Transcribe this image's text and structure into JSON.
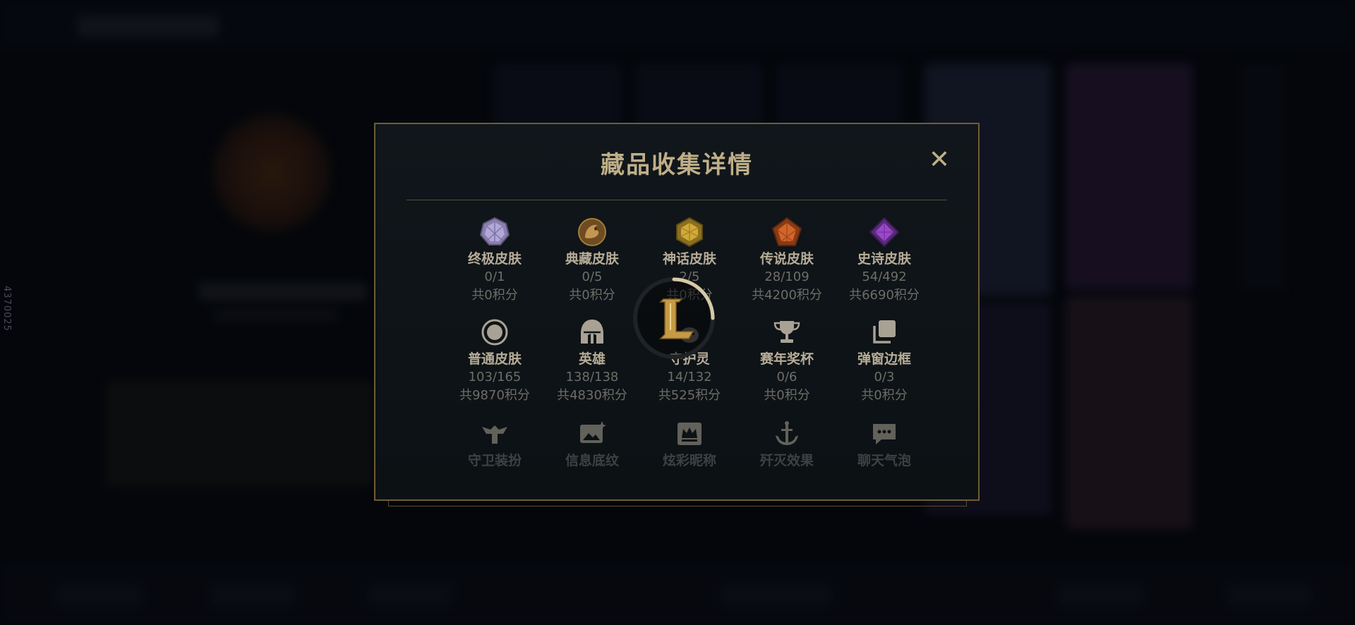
{
  "side_id": "4370025",
  "modal": {
    "title": "藏品收集详情",
    "close_label": "✕",
    "items": [
      {
        "name": "终极皮肤",
        "count": "0/1",
        "points": "共0积分",
        "icon": "ultimate-gem-icon"
      },
      {
        "name": "典藏皮肤",
        "count": "0/5",
        "points": "共0积分",
        "icon": "dragon-medallion-icon"
      },
      {
        "name": "神话皮肤",
        "count": "2/5",
        "points": "共0积分",
        "icon": "mythic-gem-icon"
      },
      {
        "name": "传说皮肤",
        "count": "28/109",
        "points": "共4200积分",
        "icon": "legendary-gem-icon"
      },
      {
        "name": "史诗皮肤",
        "count": "54/492",
        "points": "共6690积分",
        "icon": "epic-gem-icon"
      },
      {
        "name": "普通皮肤",
        "count": "103/165",
        "points": "共9870积分",
        "icon": "circle-ring-icon"
      },
      {
        "name": "英雄",
        "count": "138/138",
        "points": "共4830积分",
        "icon": "helmet-icon"
      },
      {
        "name": "守护灵",
        "count": "14/132",
        "points": "共525积分",
        "icon": "little-legend-icon"
      },
      {
        "name": "赛年奖杯",
        "count": "0/6",
        "points": "共0积分",
        "icon": "trophy-icon"
      },
      {
        "name": "弹窗边框",
        "count": "0/3",
        "points": "共0积分",
        "icon": "stacked-frames-icon"
      },
      {
        "name": "守卫装扮",
        "icon": "ward-skin-icon"
      },
      {
        "name": "信息底纹",
        "icon": "banner-image-icon"
      },
      {
        "name": "炫彩昵称",
        "icon": "crown-nameplate-icon"
      },
      {
        "name": "歼灭效果",
        "icon": "anchor-effect-icon"
      },
      {
        "name": "聊天气泡",
        "icon": "chat-bubble-icon"
      }
    ]
  },
  "colors": {
    "gold": "#bfae88",
    "border": "#6f5d35",
    "muted": "#6f6d68"
  }
}
